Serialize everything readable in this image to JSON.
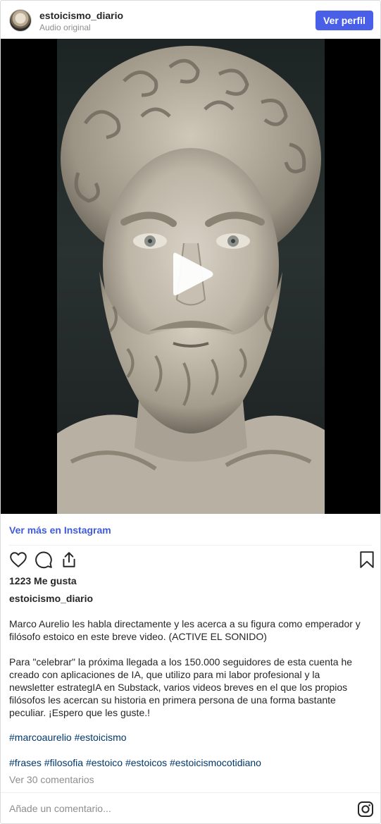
{
  "header": {
    "username": "estoicismo_diario",
    "subtitle": "Audio original",
    "profile_button": "Ver perfil"
  },
  "media": {
    "type": "video",
    "subject": "statue-bust",
    "play_icon": "play-icon"
  },
  "footer": {
    "more_link": "Ver más en Instagram",
    "likes": "1223 Me gusta",
    "author": "estoicismo_diario",
    "caption_p1": "Marco Aurelio les habla directamente y les acerca a su figura como emperador y filósofo estoico en este breve video. (ACTIVE EL SONIDO)",
    "caption_p2": "Para \"celebrar\" la próxima llegada a los 150.000 seguidores de esta cuenta he creado con aplicaciones de IA, que utilizo para mi labor profesional y la newsletter estrategIA en Substack, varios videos breves en el que los propios filósofos les acercan su historia en primera persona de una forma bastante peculiar. ¡Espero que les guste.!",
    "hashtags_line1": "#marcoaurelio #estoicismo",
    "hashtags_line2": "#frases #filosofia #estoico #estoicos #estoicismocotidiano",
    "comments": "Ver 30 comentarios",
    "comment_placeholder": "Añade un comentario..."
  },
  "icons": [
    "heart-icon",
    "comment-icon",
    "share-icon",
    "bookmark-icon",
    "instagram-icon",
    "play-icon"
  ],
  "colors": {
    "accent": "#4a5fe8",
    "link": "#3f5bd8",
    "hashtag": "#00376b",
    "muted": "#8e8e8e"
  }
}
